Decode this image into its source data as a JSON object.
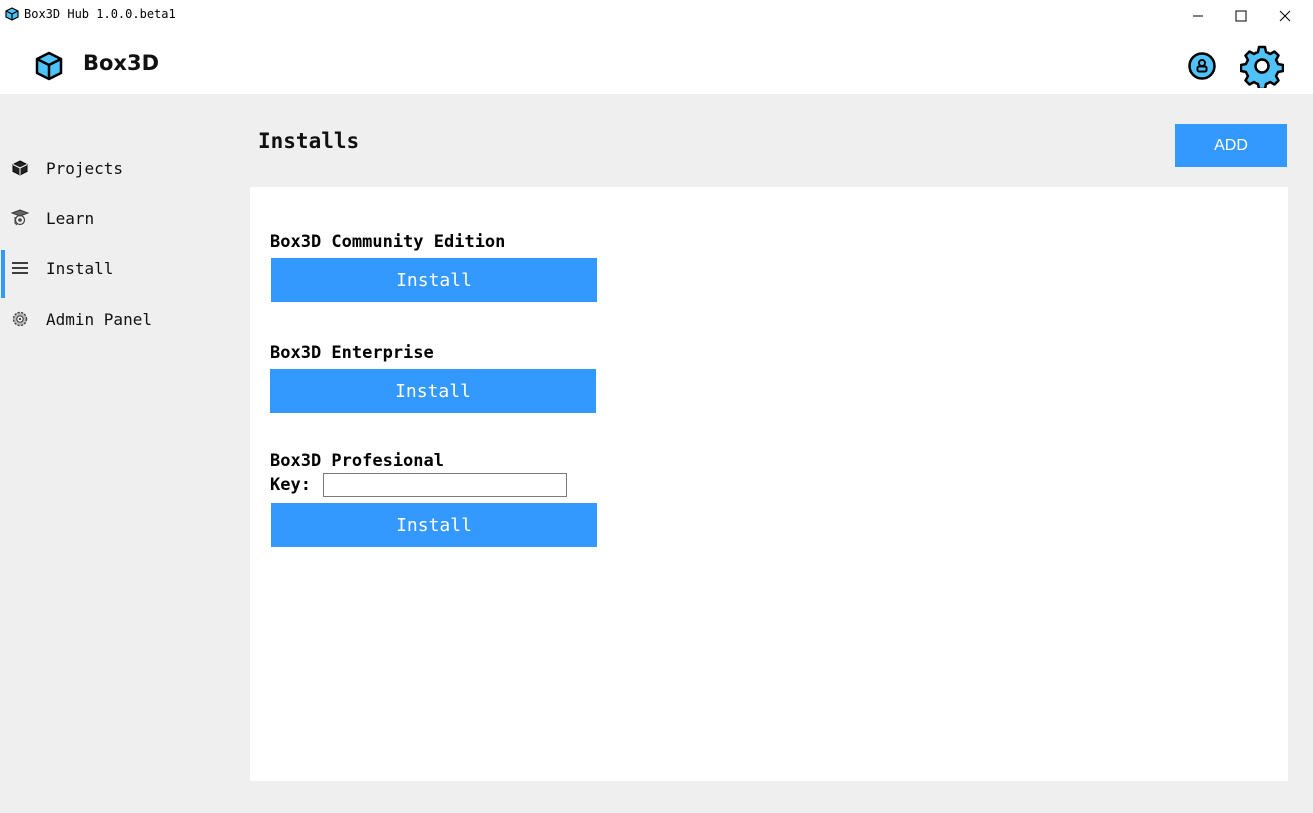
{
  "window": {
    "title": "Box3D Hub 1.0.0.beta1",
    "controls": {
      "minimize": "minimize-icon",
      "maximize": "maximize-icon",
      "close": "close-icon"
    }
  },
  "header": {
    "brand_name": "Box3D",
    "brand_icon": "cube-icon",
    "account_icon": "account-icon",
    "settings_icon": "gear-icon"
  },
  "sidebar": {
    "items": [
      {
        "label": "Projects",
        "icon": "cube-icon",
        "active": false
      },
      {
        "label": "Learn",
        "icon": "graduation-icon",
        "active": false
      },
      {
        "label": "Install",
        "icon": "menu-icon",
        "active": true
      },
      {
        "label": "Admin Panel",
        "icon": "cog-icon",
        "active": false
      }
    ]
  },
  "main": {
    "title": "Installs",
    "add_label": "ADD",
    "sections": [
      {
        "name": "Box3D Community Edition",
        "button_label": "Install"
      },
      {
        "name": "Box3D Enterprise",
        "button_label": "Install"
      },
      {
        "name": "Box3D Profesional",
        "key_label": "Key:",
        "key_value": "",
        "button_label": "Install"
      }
    ]
  },
  "colors": {
    "accent": "#3399ff",
    "background": "#efefef",
    "panel": "#ffffff",
    "icon_fill": "#4fc3f7"
  }
}
